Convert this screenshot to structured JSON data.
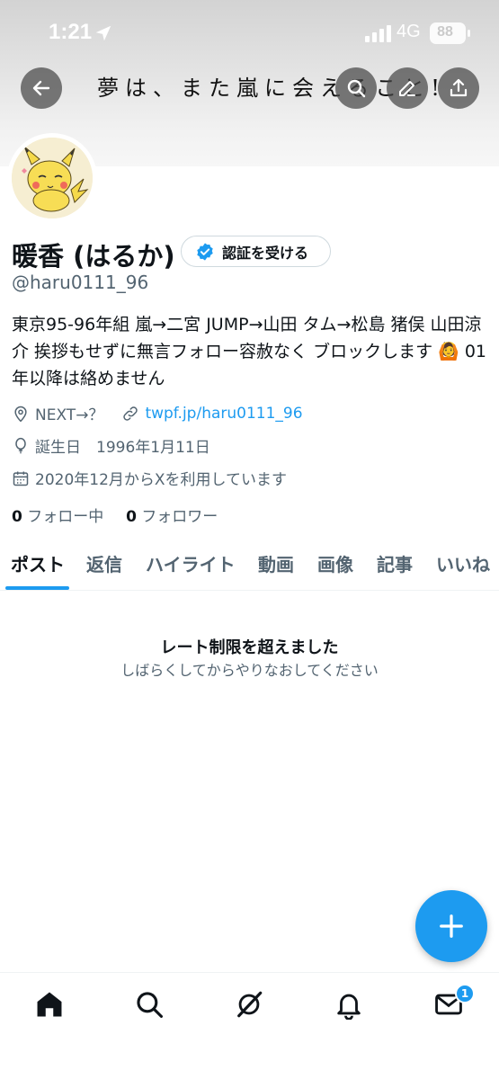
{
  "status_bar": {
    "time": "1:21",
    "network": "4G",
    "battery": "88"
  },
  "header": {
    "banner_text": "夢は、また嵐に会えること!"
  },
  "profile": {
    "display_name": "暖香 (はるか)",
    "verify_button_label": "認証を受ける",
    "handle": "@haru0111_96",
    "bio": "東京95-96年組 嵐→二宮 JUMP→山田 タム→松島 猪俣 山田涼介 挨拶もせずに無言フォロー容赦なく ブロックします 🙆 01年以降は絡めません",
    "location": "NEXT→？",
    "website": "twpf.jp/haru0111_96",
    "birthday": "誕生日　1996年1月11日",
    "joined": "2020年12月からXを利用しています",
    "following_count": "0",
    "following_label": "フォロー中",
    "followers_count": "0",
    "followers_label": "フォロワー"
  },
  "tabs": [
    {
      "label": "ポスト"
    },
    {
      "label": "返信"
    },
    {
      "label": "ハイライト"
    },
    {
      "label": "動画"
    },
    {
      "label": "画像"
    },
    {
      "label": "記事"
    },
    {
      "label": "いいね"
    }
  ],
  "content": {
    "rate_limit_title": "レート制限を超えました",
    "rate_limit_subtitle": "しばらくしてからやりなおしてください"
  },
  "bottom_nav": {
    "messages_badge": "1"
  },
  "colors": {
    "accent": "#1d9bf0",
    "text_primary": "#0f1419",
    "text_secondary": "#536471"
  }
}
